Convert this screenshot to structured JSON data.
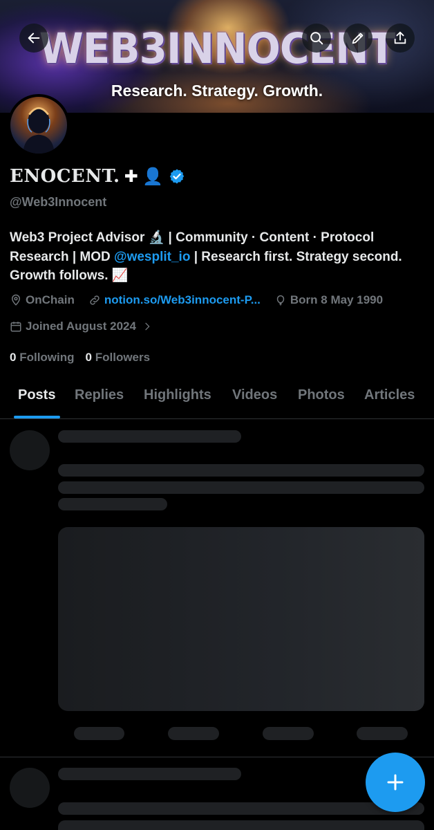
{
  "banner": {
    "title": "WEB3INNOCENT",
    "subtitle": "Research. Strategy. Growth."
  },
  "header": {
    "back_icon": "arrow-left-icon",
    "search_icon": "search-icon",
    "edit_icon": "pencil-icon",
    "share_icon": "share-icon"
  },
  "profile": {
    "display_name": "ENOCENT.",
    "name_emojis": "✚ 👤",
    "handle": "@Web3Innocent",
    "verified_color": "#1d9bf0",
    "bio_line1": "Web3 Project Advisor 🔬 | Community · Content · Protocol",
    "bio_line2_a": "Research | MOD ",
    "bio_mention": "@wesplit_io",
    "bio_line2_b": " | Research first. Strategy second.",
    "bio_line3": "Growth follows. 📈",
    "location": "OnChain",
    "website": "notion.so/Web3innocent-P...",
    "birthday": "Born 8 May 1990",
    "joined": "Joined August 2024",
    "following_count": "0",
    "following_label": "Following",
    "followers_count": "0",
    "followers_label": "Followers"
  },
  "tabs": [
    {
      "label": "Posts"
    },
    {
      "label": "Replies"
    },
    {
      "label": "Highlights"
    },
    {
      "label": "Videos"
    },
    {
      "label": "Photos"
    },
    {
      "label": "Articles"
    }
  ],
  "active_tab": "Posts",
  "fab": {
    "icon": "plus-icon"
  },
  "colors": {
    "accent": "#1d9bf0",
    "background": "#000000",
    "muted_text": "#71767b",
    "primary_text": "#e7e9ea"
  }
}
